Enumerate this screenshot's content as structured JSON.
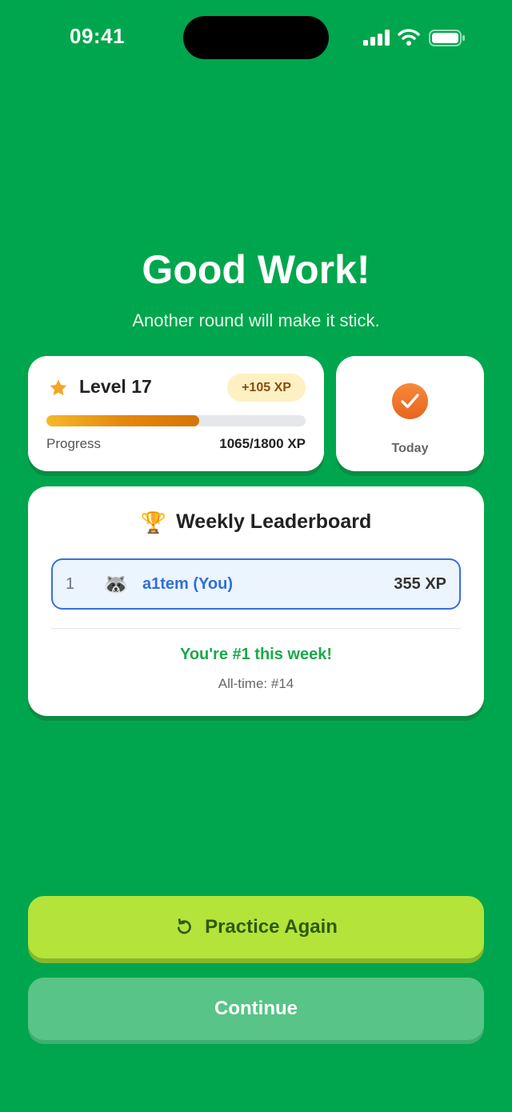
{
  "status_bar": {
    "time": "09:41"
  },
  "header": {
    "title": "Good Work!",
    "subtitle": "Another round will make it stick."
  },
  "level_card": {
    "level_label": "Level 17",
    "xp_gained": "+105 XP",
    "progress_label": "Progress",
    "progress_value": "1065/1800 XP",
    "progress_fraction": 0.59
  },
  "today_card": {
    "label": "Today"
  },
  "leaderboard": {
    "title": "Weekly Leaderboard",
    "entries": [
      {
        "rank": "1",
        "avatar": "🦝",
        "name": "a1tem (You)",
        "xp": "355 XP"
      }
    ],
    "rank_message": "You're #1 this week!",
    "alltime": "All-time: #14"
  },
  "actions": {
    "practice_label": "Practice Again",
    "continue_label": "Continue"
  },
  "colors": {
    "background": "#00A64D",
    "practice_button": "#B4E43A",
    "continue_button": "#58C487",
    "highlight_blue": "#3A71D6",
    "progress_orange": "#E3880E"
  }
}
